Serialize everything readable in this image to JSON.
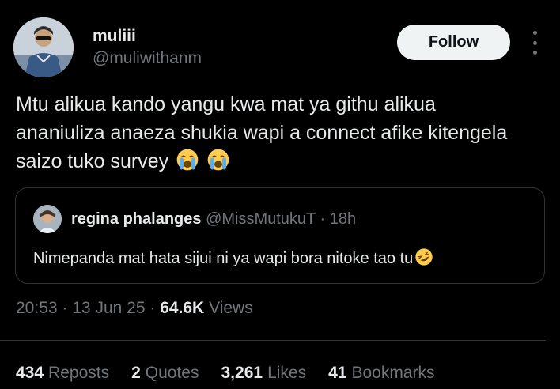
{
  "author": {
    "name": "muliii",
    "handle": "@muliwithanm",
    "follow_label": "Follow"
  },
  "tweet": {
    "text": "Mtu alikua kando yangu kwa mat ya githu alikua ananiuliza anaeza shukia wapi a connect afike kitengela saizo tuko survey",
    "emojis": [
      "loudly-crying-face-icon",
      "loudly-crying-face-icon"
    ]
  },
  "quoted": {
    "name": "regina phalanges",
    "handle": "@MissMutukuT",
    "separator": "·",
    "time": "18h",
    "text": "Nimepanda mat hata sijui ni ya wapi bora nitoke tao tu",
    "emoji": "rolling-on-floor-laughing-icon"
  },
  "meta": {
    "time": "20:53",
    "sep1": "·",
    "date": "13 Jun 25",
    "sep2": "·",
    "views_count": "64.6K",
    "views_label": "Views"
  },
  "stats": [
    {
      "count": "434",
      "label": "Reposts"
    },
    {
      "count": "2",
      "label": "Quotes"
    },
    {
      "count": "3,261",
      "label": "Likes"
    },
    {
      "count": "41",
      "label": "Bookmarks"
    }
  ],
  "colors": {
    "background": "#000000",
    "text": "#e7e9ea",
    "muted": "#71767b",
    "border": "#2f3336",
    "follow_bg": "#eff3f4"
  }
}
